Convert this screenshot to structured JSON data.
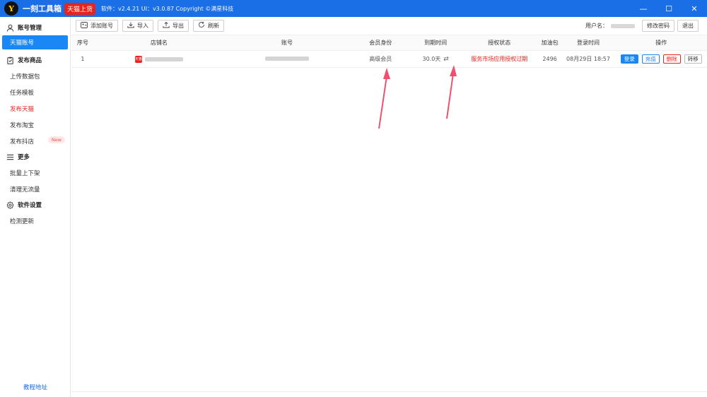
{
  "titlebar": {
    "logo_glyph": "Y",
    "app_name": "一刻工具箱",
    "badge": "天猫上货",
    "version_text": "软件：v2.4.21   UI：v3.0.87   Copyright ©满星科技",
    "min": "—",
    "max": "☐",
    "close": "✕"
  },
  "sidebar": {
    "sections": [
      {
        "title": "账号管理",
        "icon": "user-icon"
      },
      {
        "title": "发布商品",
        "icon": "clipboard-icon"
      },
      {
        "title": "更多",
        "icon": "menu-icon"
      },
      {
        "title": "软件设置",
        "icon": "gear-icon"
      }
    ],
    "items": {
      "tmall_account": "天猫账号",
      "upload_pack": "上传数据包",
      "task_template": "任务模板",
      "publish_tmall": "发布天猫",
      "publish_taobao": "发布淘宝",
      "publish_douyin": "发布抖店",
      "new_badge": "New",
      "batch_shelf": "批量上下架",
      "clean_traffic": "清理无流量",
      "check_update": "检测更新"
    },
    "tutorial": "教程地址"
  },
  "toolbar": {
    "add_account": "添加账号",
    "import": "导入",
    "export": "导出",
    "refresh": "刷新",
    "user_label": "用户名：",
    "change_password": "修改密码",
    "logout": "退出"
  },
  "table": {
    "headers": {
      "no": "序号",
      "shop": "店铺名",
      "account": "账号",
      "member": "会员身份",
      "expire": "到期时间",
      "auth": "授权状态",
      "pack": "加油包",
      "login_time": "登录时间",
      "ops": "操作"
    },
    "rows": [
      {
        "no": "1",
        "shop_icon_text": "天猫",
        "member": "高级会员",
        "expire": "30.0天",
        "auth": "服务市场应用授权过期",
        "pack": "2496",
        "login_time": "08月29日 18:57",
        "op_login": "登录",
        "op_recharge": "充值",
        "op_delete": "删除",
        "op_transfer": "转移"
      }
    ]
  },
  "colors": {
    "titlebar": "#1b6fe6",
    "accent": "#1b87f5",
    "danger": "#e8231a",
    "arrow": "#f0506e"
  }
}
